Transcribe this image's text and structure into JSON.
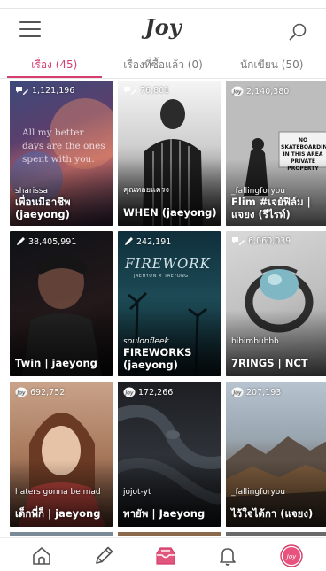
{
  "app": {
    "logo": "Joy"
  },
  "tabs": [
    {
      "label": "เรื่อง (45)",
      "active": true
    },
    {
      "label": "เรื่องที่ซื้อแล้ว (0)",
      "active": false
    },
    {
      "label": "นักเขียน (50)",
      "active": false
    }
  ],
  "stories": [
    {
      "views": "1,121,196",
      "author": "sharissa",
      "title": "เพื่อนมีอาชีพ (jaeyong)",
      "view_icon": "chat-pen-icon",
      "cover_text": "All my better days are the ones spent with you."
    },
    {
      "views": "76,801",
      "author": "คุณหอยแครง",
      "title": "WHEN (jaeyong)",
      "view_icon": "chat-pen-icon"
    },
    {
      "views": "2,140,380",
      "author": "_fallingforyou",
      "title": "Flim #เจย์ฟิล์ม | แจยง (รีไรท์)",
      "view_icon": "joy-icon",
      "cover_text": "NO SKATEBOARDING IN THIS AREA PRIVATE PROPERTY"
    },
    {
      "views": "38,405,991",
      "author": "",
      "title": "Twin | jaeyong",
      "view_icon": "pen-icon"
    },
    {
      "views": "242,191",
      "author": "soulonfleek",
      "title": "FIREWORKS (jaeyong)",
      "view_icon": "pen-icon",
      "cover_text": "FIREWORK",
      "cover_sub": "JAEHYUN × TAEYONG"
    },
    {
      "views": "6,060,039",
      "author": "bibimbubbb",
      "title": "7RINGS | NCT",
      "view_icon": "chat-pen-icon"
    },
    {
      "views": "692,752",
      "author": "haters gonna be mad",
      "title": "เด็กพี่ก็ | jaeyong",
      "view_icon": "joy-icon"
    },
    {
      "views": "172,266",
      "author": "jojot-yt",
      "title": "พายัพ | Jaeyong",
      "view_icon": "joy-icon"
    },
    {
      "views": "207,193",
      "author": "_fallingforyou",
      "title": "ไว้ใจได้กา (แจยง)",
      "view_icon": "joy-icon"
    }
  ],
  "colors": {
    "accent": "#d43f6d",
    "tab_inactive": "#7a7a7a"
  },
  "bottom_nav": [
    "home-icon",
    "pencil-icon",
    "inbox-icon",
    "bell-icon",
    "profile-avatar"
  ]
}
